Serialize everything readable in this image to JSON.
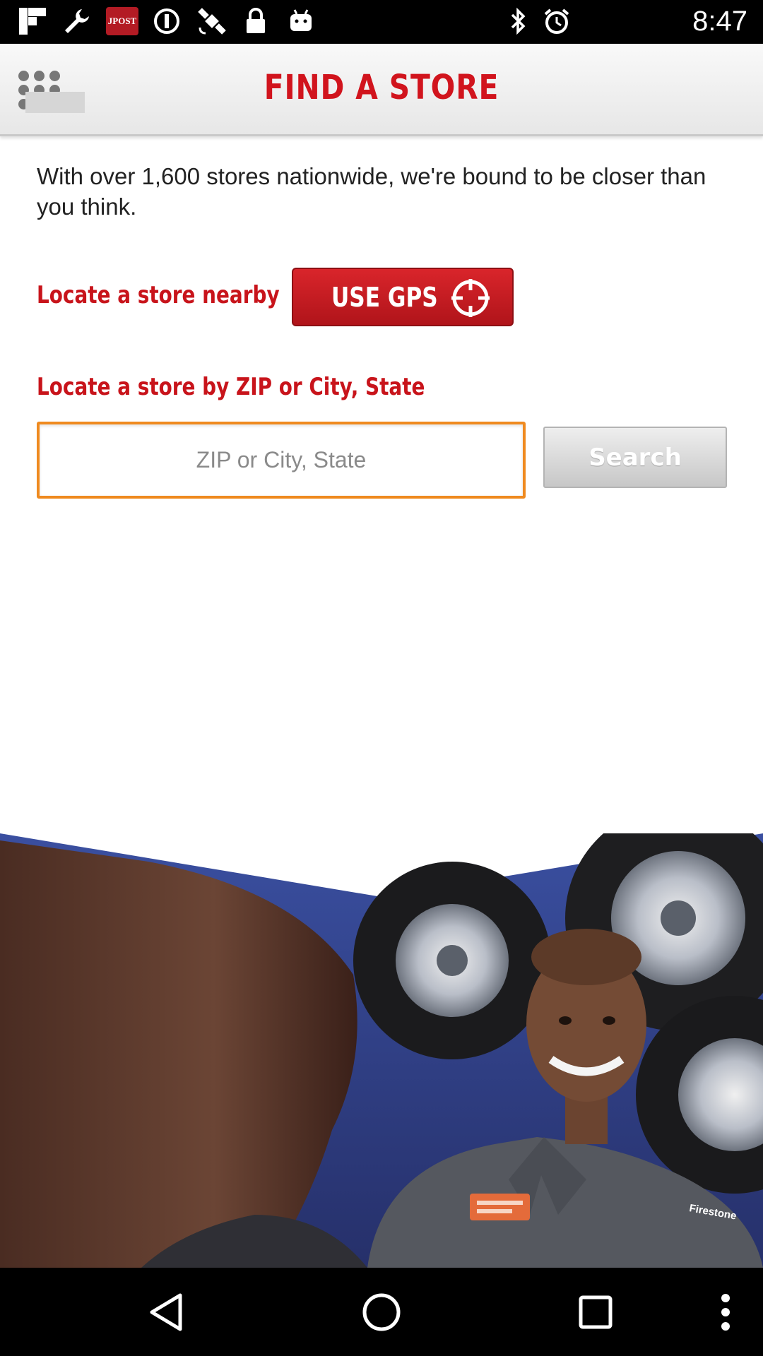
{
  "status_bar": {
    "time": "8:47",
    "notification_icons": [
      "flipboard-icon",
      "wrench-icon",
      "jpost-icon",
      "circle-info-icon",
      "satellite-icon",
      "lock-icon",
      "android-icon"
    ],
    "jpost_label": "JPOST",
    "system_icons": [
      "bluetooth-icon",
      "alarm-clock-icon"
    ]
  },
  "header": {
    "title": "FIND A STORE",
    "menu_icon": "grid-menu-icon"
  },
  "intro_text": "With over 1,600 stores nationwide, we're bound to be closer than you think.",
  "nearby": {
    "label": "Locate a store nearby",
    "gps_button": "USE GPS",
    "gps_icon": "crosshair-icon"
  },
  "zip_search": {
    "label": "Locate a store by ZIP or City, State",
    "input_value": "",
    "placeholder": "ZIP or City, State",
    "search_button": "Search"
  },
  "hero_image": {
    "badge_logo_text": "Firestone"
  },
  "nav_bar": {
    "icons": [
      "back-icon",
      "home-icon",
      "recents-icon",
      "more-icon"
    ]
  },
  "colors": {
    "brand_red": "#d1141d",
    "input_border": "#ef8a1f",
    "search_button": "#d0d0d0"
  }
}
